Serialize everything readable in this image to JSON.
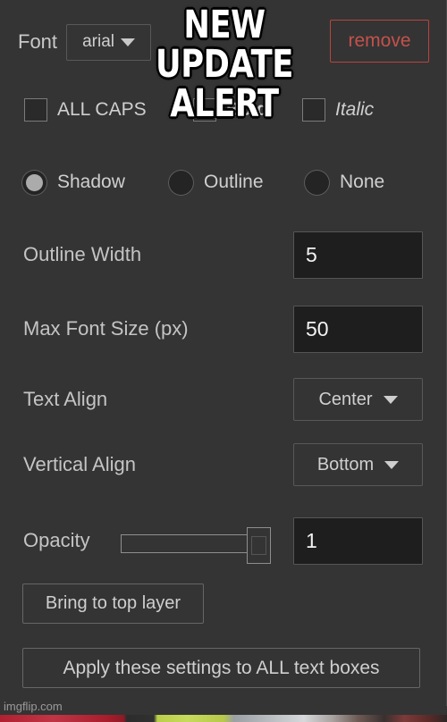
{
  "panel": {
    "font_row": {
      "label": "Font",
      "font_value": "arial",
      "remove_label": "remove"
    },
    "style_checks": [
      {
        "name": "all-caps",
        "label": "ALL CAPS",
        "checked": false
      },
      {
        "name": "bold",
        "label": "Bold",
        "checked": false
      },
      {
        "name": "italic",
        "label": "Italic",
        "checked": false
      }
    ],
    "effect_radios": [
      {
        "name": "shadow",
        "label": "Shadow",
        "checked": true
      },
      {
        "name": "outline",
        "label": "Outline",
        "checked": false
      },
      {
        "name": "none",
        "label": "None",
        "checked": false
      }
    ],
    "outline_width": {
      "label": "Outline Width",
      "value": "5"
    },
    "max_font_size": {
      "label": "Max Font Size (px)",
      "value": "50"
    },
    "text_align": {
      "label": "Text Align",
      "value": "Center"
    },
    "vertical_align": {
      "label": "Vertical Align",
      "value": "Bottom"
    },
    "opacity": {
      "label": "Opacity",
      "value": "1",
      "slider_percent": 100
    },
    "bring_to_top_label": "Bring to top layer",
    "apply_all_label": "Apply these settings to ALL text boxes"
  },
  "overlay": {
    "meme_line1": "NEW",
    "meme_line2": "UPDATE ALERT"
  },
  "watermark": "imgflip.com",
  "colors": {
    "panel_bg": "#343434",
    "input_bg": "#1e1e1e",
    "text": "#cfcfcf",
    "border": "#585858",
    "remove_red": "#c4514c",
    "radio_dot": "#ababab"
  }
}
